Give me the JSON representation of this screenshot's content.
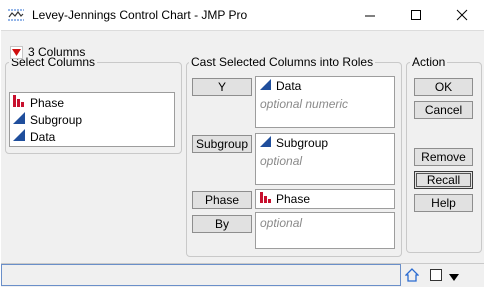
{
  "window": {
    "title": "Levey-Jennings Control Chart - JMP Pro",
    "app_icon": "control-chart-icon",
    "controls": [
      "minimize-icon",
      "maximize-icon",
      "close-icon"
    ]
  },
  "select_columns": {
    "heading": "Select Columns",
    "count_label": "3 Columns",
    "items": [
      {
        "label": "Phase",
        "icon": "nominal-icon"
      },
      {
        "label": "Subgroup",
        "icon": "continuous-icon"
      },
      {
        "label": "Data",
        "icon": "continuous-icon"
      }
    ]
  },
  "roles": {
    "heading": "Cast Selected Columns into Roles",
    "rows": [
      {
        "button": "Y",
        "value": "Data",
        "icon": "continuous-icon",
        "hint": "optional numeric"
      },
      {
        "button": "Subgroup",
        "value": "Subgroup",
        "icon": "continuous-icon",
        "hint": "optional"
      },
      {
        "button": "Phase",
        "value": "Phase",
        "icon": "nominal-icon",
        "hint": ""
      },
      {
        "button": "By",
        "value": "",
        "icon": "",
        "hint": "optional"
      }
    ]
  },
  "action": {
    "heading": "Action",
    "buttons": [
      "OK",
      "Cancel",
      "Remove",
      "Recall",
      "Help"
    ]
  },
  "colors": {
    "nominal_red": "#c8102e",
    "continuous_blue": "#1f4e9c",
    "status_outline": "#6a8fc9"
  },
  "statusbar": {
    "icons": [
      "home-icon",
      "window-toggle-icon",
      "dropdown-icon"
    ]
  }
}
